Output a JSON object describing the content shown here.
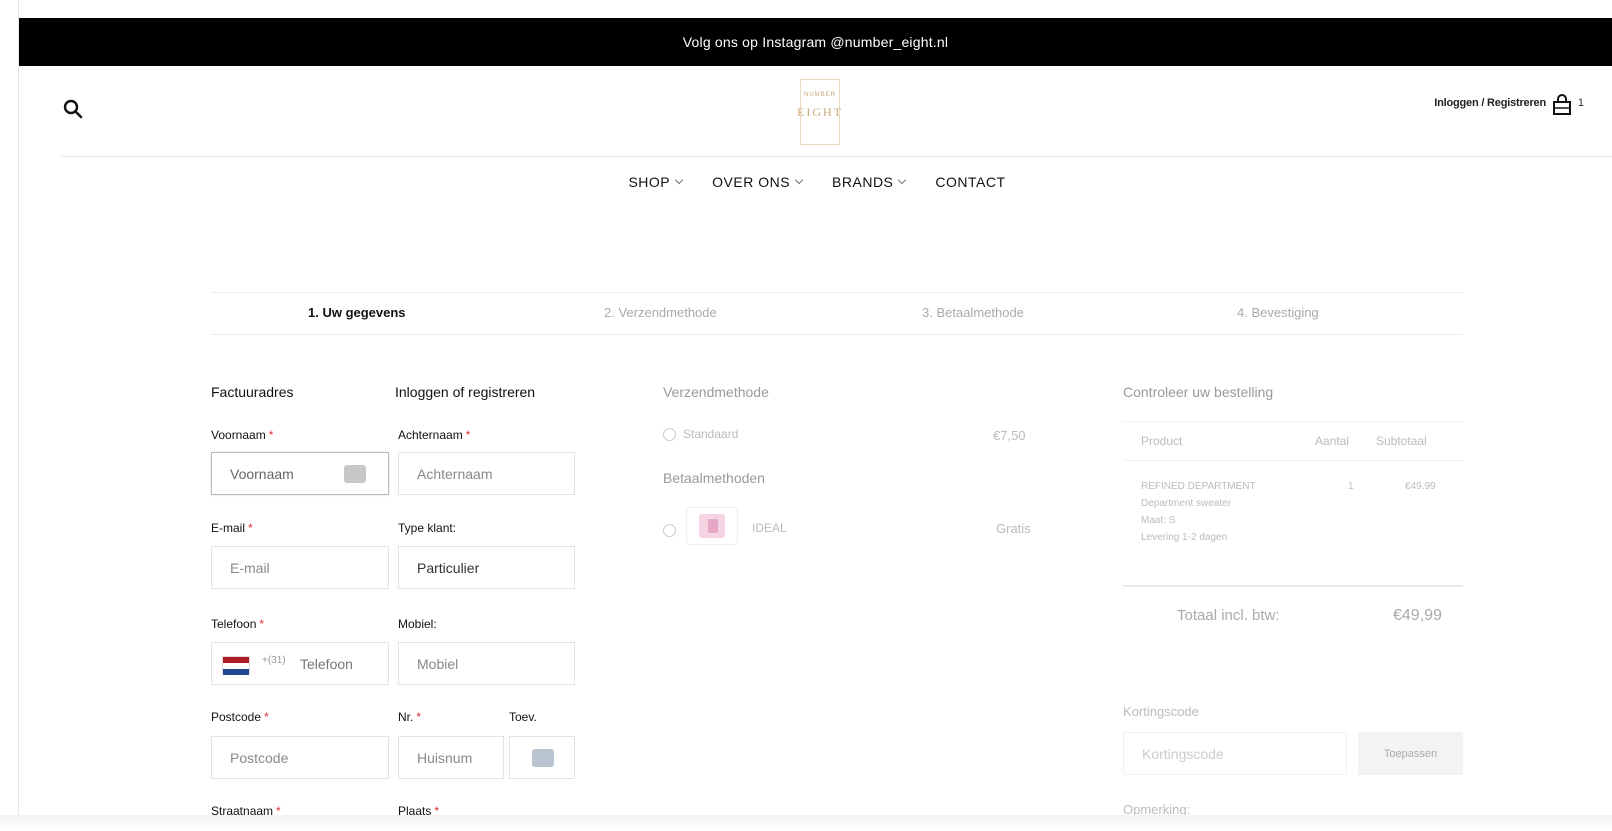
{
  "announcement": "Volg ons op Instagram @number_eight.nl",
  "header": {
    "logo_top": "NUMBER",
    "logo_text": "EIGHT",
    "login_register": "Inloggen / Registreren",
    "cart_count": "1"
  },
  "nav": {
    "items": [
      {
        "label": "SHOP",
        "dropdown": true
      },
      {
        "label": "OVER ONS",
        "dropdown": true
      },
      {
        "label": "BRANDS",
        "dropdown": true
      },
      {
        "label": "CONTACT",
        "dropdown": false
      }
    ]
  },
  "steps": [
    {
      "label": "1.  Uw gegevens",
      "active": true
    },
    {
      "label": "2.  Verzendmethode",
      "active": false
    },
    {
      "label": "3.  Betaalmethode",
      "active": false
    },
    {
      "label": "4.  Bevestiging",
      "active": false
    }
  ],
  "billing": {
    "title": "Factuuradres",
    "login_title": "Inloggen of registreren",
    "first_name_label": "Voornaam",
    "first_name_placeholder": "Voornaam",
    "last_name_label": "Achternaam",
    "last_name_placeholder": "Achternaam",
    "email_label": "E-mail",
    "email_placeholder": "E-mail",
    "client_type_label": "Type klant:",
    "client_type_value": "Particulier",
    "phone_label": "Telefoon",
    "phone_country_code": "+(31)",
    "phone_placeholder": "Telefoon",
    "mobile_label": "Mobiel:",
    "mobile_placeholder": "Mobiel",
    "postcode_label": "Postcode",
    "postcode_placeholder": "Postcode",
    "nr_label": "Nr.",
    "nr_placeholder": "Huisnum",
    "suffix_label": "Toev.",
    "street_label": "Straatnaam",
    "city_label": "Plaats",
    "required_mark": "*"
  },
  "shipping": {
    "title": "Verzendmethode",
    "option_label": "Standaard",
    "option_price": "€7,50",
    "payment_title": "Betaalmethoden",
    "payment_option": "IDEAL",
    "payment_price": "Gratis"
  },
  "order": {
    "title": "Controleer uw bestelling",
    "col_product": "Product",
    "col_qty": "Aantal",
    "col_subtotal": "Subtotaal",
    "item_brand": "REFINED DEPARTMENT",
    "item_name": "Department sweater",
    "item_size": "Maat: S",
    "item_delivery": "Levering 1-2 dagen",
    "item_qty": "1",
    "item_price": "€49,99",
    "total_label": "Totaal incl. btw:",
    "total_value": "€49,99",
    "coupon_label": "Kortingscode",
    "coupon_placeholder": "Kortingscode",
    "coupon_button": "Toepassen",
    "remark_label": "Opmerking:"
  },
  "colors": {
    "announcement_bg": "#000000",
    "logo_gold": "#c9a978",
    "required": "#dd3333",
    "flag_red": "#ae1c28",
    "flag_white": "#ffffff",
    "flag_blue": "#21468b"
  }
}
